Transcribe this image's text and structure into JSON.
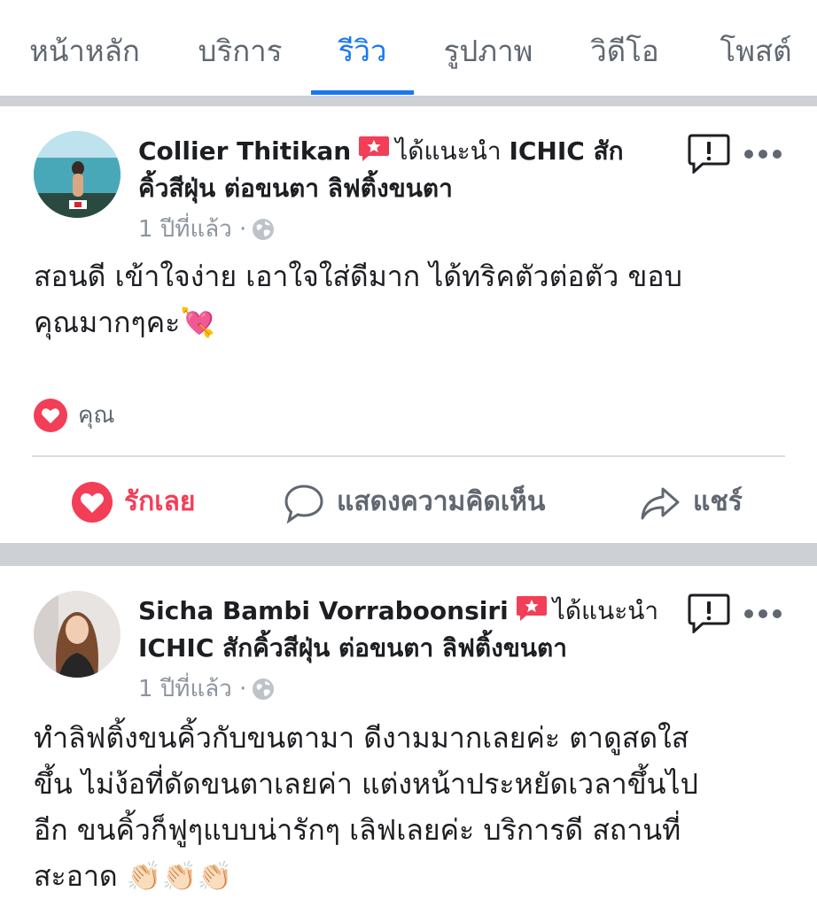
{
  "tabs": [
    {
      "label": "หน้าหลัก",
      "active": false
    },
    {
      "label": "บริการ",
      "active": false
    },
    {
      "label": "รีวิว",
      "active": true
    },
    {
      "label": "รูปภาพ",
      "active": false
    },
    {
      "label": "วิดีโอ",
      "active": false
    },
    {
      "label": "โพสต์",
      "active": false
    }
  ],
  "posts": [
    {
      "author": "Collier Thitikan",
      "recommend_text": "ได้แนะนำ",
      "page_line1": "ICHIC สัก",
      "page_line2": "คิ้วสีฝุ่น ต่อขนตา ลิฟติ้งขนตา",
      "time": "1 ปีที่แล้ว ·",
      "body_line1": "สอนดี เข้าใจง่าย เอาใจใส่ดีมาก ได้ทริคตัวต่อตัว ขอบ",
      "body_line2": "คุณมากๆคะ💘",
      "reaction_label": "คุณ",
      "actions": {
        "love": "รักเลย",
        "comment": "แสดงความคิดเห็น",
        "share": "แชร์"
      }
    },
    {
      "author": "Sicha Bambi Vorraboonsiri",
      "recommend_text": "ได้แนะนำ",
      "page_line2": "ICHIC สักคิ้วสีฝุ่น ต่อขนตา ลิฟติ้งขนตา",
      "time": "1 ปีที่แล้ว ·",
      "body_line1": "ทำลิฟติ้งขนคิ้วกับขนตามา ดีงามมากเลยค่ะ ตาดูสดใส",
      "body_line2": "ขึ้น ไม่ง้อที่ดัดขนตาเลยค่า แต่งหน้าประหยัดเวลาขึ้นไป",
      "body_line3": "อีก ขนคิ้วก็ฟูๆแบบน่ารักๆ เลิฟเลยค่ะ บริการดี สถานที่",
      "body_line4": "สะอาด 👏🏻👏🏻👏🏻"
    }
  ],
  "colors": {
    "accent": "#1877f2",
    "love": "#f33e58",
    "separator": "#cdd0d5",
    "muted": "#606770"
  },
  "icons": [
    "recommend-star-icon",
    "globe-icon",
    "report-icon",
    "more-icon",
    "heart-icon",
    "comment-icon",
    "share-icon"
  ]
}
